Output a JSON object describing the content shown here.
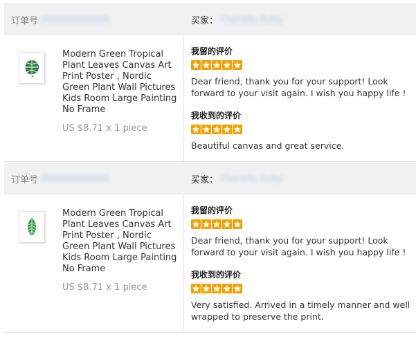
{
  "orders": [
    {
      "order_no_label": "订单号",
      "order_no_value": "0000000000000",
      "buyer_label": "买家：",
      "buyer_value": "Chanelle Duley",
      "product_title": "Modern Green Tropical Plant Leaves Canvas Art Print Poster , Nordic Green Plant Wall Pictures Kids Room Large Painting No Frame",
      "product_price": "US $8.71 x 1 piece",
      "thumb_icon": "monstera-leaf-print-icon",
      "my_review_title": "我留的评价",
      "my_review_stars": 5,
      "my_review_text": "Dear friend, thank you for your support! Look forward to your visit again. I wish you happy life !",
      "received_review_title": "我收到的评价",
      "received_review_stars": 5,
      "received_review_text": "Beautiful canvas and great service."
    },
    {
      "order_no_label": "订单号",
      "order_no_value": "0000000000000",
      "buyer_label": "买家：",
      "buyer_value": "Chanelle Duley",
      "product_title": "Modern Green Tropical Plant Leaves Canvas Art Print Poster , Nordic Green Plant Wall Pictures Kids Room Large Painting No Frame",
      "product_price": "US $8.71 x 1 piece",
      "thumb_icon": "banana-leaf-print-icon",
      "my_review_title": "我留的评价",
      "my_review_stars": 5,
      "my_review_text": "Dear friend, thank you for your support! Look forward to your visit again. I wish you happy life !",
      "received_review_title": "我收到的评价",
      "received_review_stars": 5,
      "received_review_text": "Very satisfied. Arrived in a timely manner and well wrapped to preserve the print."
    }
  ],
  "colors": {
    "star": "#f5a000",
    "header_bg": "#f1f1f1",
    "text": "#333333",
    "muted": "#999999",
    "leaf": "#2e8b4a"
  }
}
